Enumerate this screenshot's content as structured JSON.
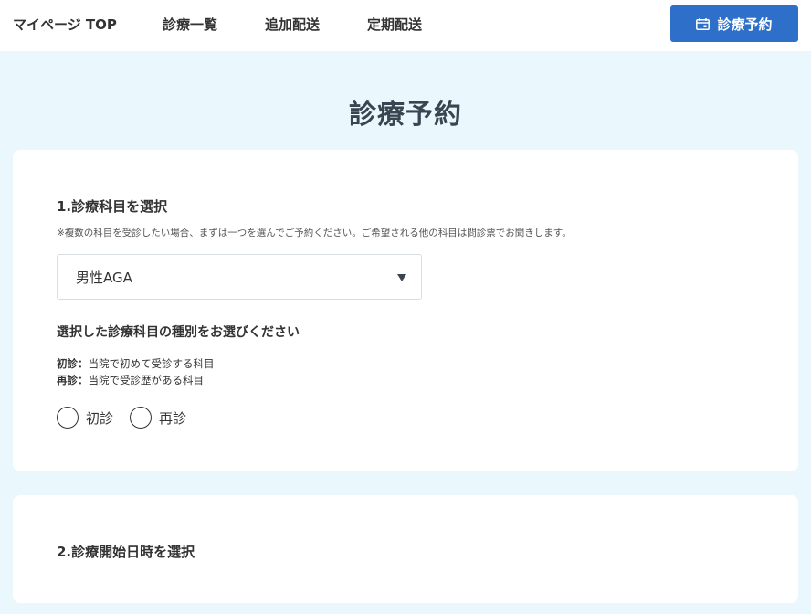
{
  "nav": {
    "mypage": "マイページ TOP",
    "list": "診療一覧",
    "additional": "追加配送",
    "regular": "定期配送",
    "reserve_button": "診療予約"
  },
  "page": {
    "title": "診療予約"
  },
  "section1": {
    "heading": "1.診療科目を選択",
    "note": "※複数の科目を受診したい場合、まずは一つを選んでご予約ください。ご希望される他の科目は問診票でお聞きします。",
    "select_value": "男性AGA",
    "subheading": "選択した診療科目の種別をお選びください",
    "definitions": [
      {
        "term": "初診：",
        "desc": "当院で初めて受診する科目"
      },
      {
        "term": "再診：",
        "desc": "当院で受診歴がある科目"
      }
    ],
    "radios": [
      {
        "label": "初診"
      },
      {
        "label": "再診"
      }
    ]
  },
  "section2": {
    "heading": "2.診療開始日時を選択"
  },
  "colors": {
    "accent": "#2d6fc9",
    "background": "#eaf7fd"
  },
  "icons": {
    "reserve": "calendar-icon",
    "dropdown": "caret-down-icon"
  }
}
